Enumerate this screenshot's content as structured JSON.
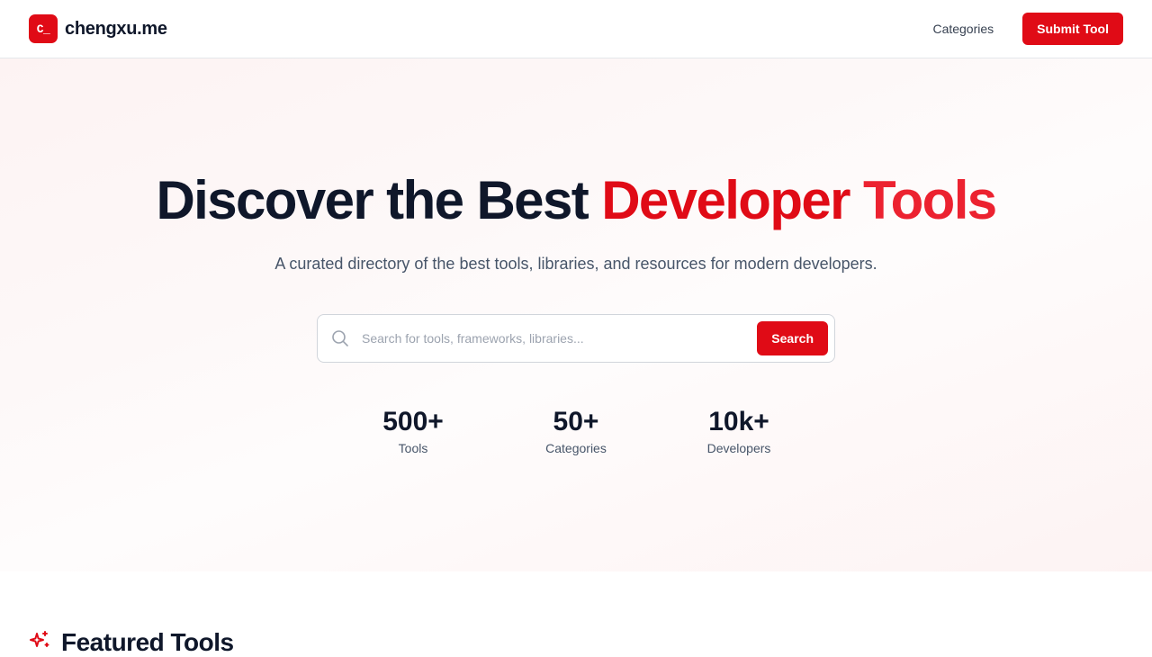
{
  "brand": {
    "logo_text": "C_",
    "name": "chengxu.me"
  },
  "nav": {
    "categories_label": "Categories",
    "submit_label": "Submit Tool"
  },
  "hero": {
    "title_part1": "Discover the Best ",
    "title_part2": "Developer ",
    "title_part3": "Tools",
    "subtitle": "A curated directory of the best tools, libraries, and resources for modern developers."
  },
  "search": {
    "placeholder": "Search for tools, frameworks, libraries...",
    "value": "",
    "button_label": "Search",
    "icon": "search-icon"
  },
  "stats": [
    {
      "value": "500+",
      "label": "Tools"
    },
    {
      "value": "50+",
      "label": "Categories"
    },
    {
      "value": "10k+",
      "label": "Developers"
    }
  ],
  "featured": {
    "icon": "sparkles-icon",
    "title": "Featured Tools"
  },
  "colors": {
    "accent": "#e00b16",
    "text_dark": "#0f172a",
    "text_muted": "#475569"
  }
}
